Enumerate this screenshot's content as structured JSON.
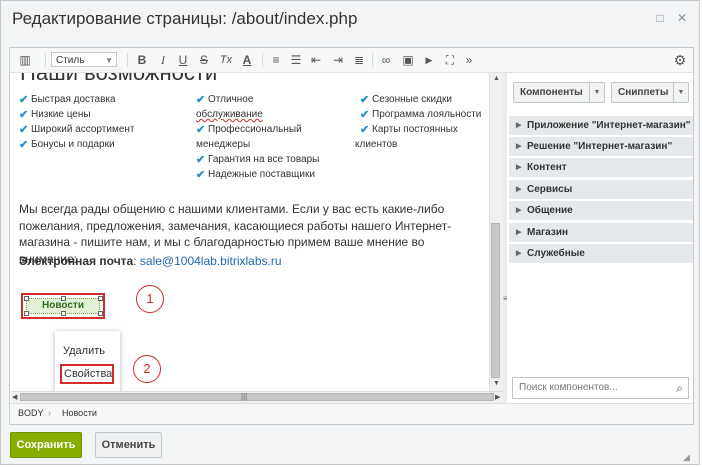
{
  "dialog": {
    "title": "Редактирование страницы: /about/index.php",
    "maximize_icon": "□",
    "close_icon": "✕"
  },
  "toolbar": {
    "view_icon": "▥",
    "style_label": "Стиль",
    "bold": "B",
    "italic": "I",
    "underline": "U",
    "strike": "S",
    "clear_format": "Tx",
    "font_color": "A",
    "ordered_list": "≡",
    "unordered_list": "☰",
    "outdent": "⇤",
    "indent": "⇥",
    "align": "≣",
    "link": "∞",
    "image": "▣",
    "video": "▶",
    "fullscreen": "⛶",
    "more": "»",
    "settings": "⚙"
  },
  "content": {
    "heading": "Наши возможности",
    "col1": [
      "Быстрая доставка",
      "Низкие цены",
      "Широкий ассортимент",
      "Бонусы и подарки"
    ],
    "col2_a_line1": "Отличное",
    "col2_a_line2": "обслуживание",
    "col2_b_line1": "Профессиональный",
    "col2_b_line2": "менеджеры",
    "col2_c": "Гарантия на все товары",
    "col2_d": "Надежные поставщики",
    "col3_a": "Сезонные скидки",
    "col3_b": "Программа лояльности",
    "col3_c_line1": "Карты постоянных",
    "col3_c_line2": "клиентов",
    "paragraph": "Мы всегда рады общению с нашими клиентами. Если у вас есть какие-либо пожелания, предложения, замечания, касающиеся работы нашего Интернет-магазина - пишите нам, и мы с благодарностью примем ваше мнение во внимание:",
    "email_label": "Электронная почта",
    "email_sep": ": ",
    "email_value": "sale@1004lab.bitrixlabs.ru",
    "component_label": "Новости",
    "callout1": "1",
    "callout2": "2"
  },
  "context_menu": {
    "delete": "Удалить",
    "properties": "Свойства"
  },
  "panel": {
    "components_btn": "Компоненты",
    "snippets_btn": "Сниппеты",
    "items": [
      "Приложение \"Интернет-магазин\"",
      "Решение \"Интернет-магазин\"",
      "Контент",
      "Сервисы",
      "Общение",
      "Магазин",
      "Служебные"
    ],
    "search_placeholder": "Поиск компонентов...",
    "search_icon": "🔍"
  },
  "statusbar": {
    "body": "BODY",
    "sep": "›",
    "news": "Новости"
  },
  "footer": {
    "save": "Сохранить",
    "cancel": "Отменить"
  }
}
